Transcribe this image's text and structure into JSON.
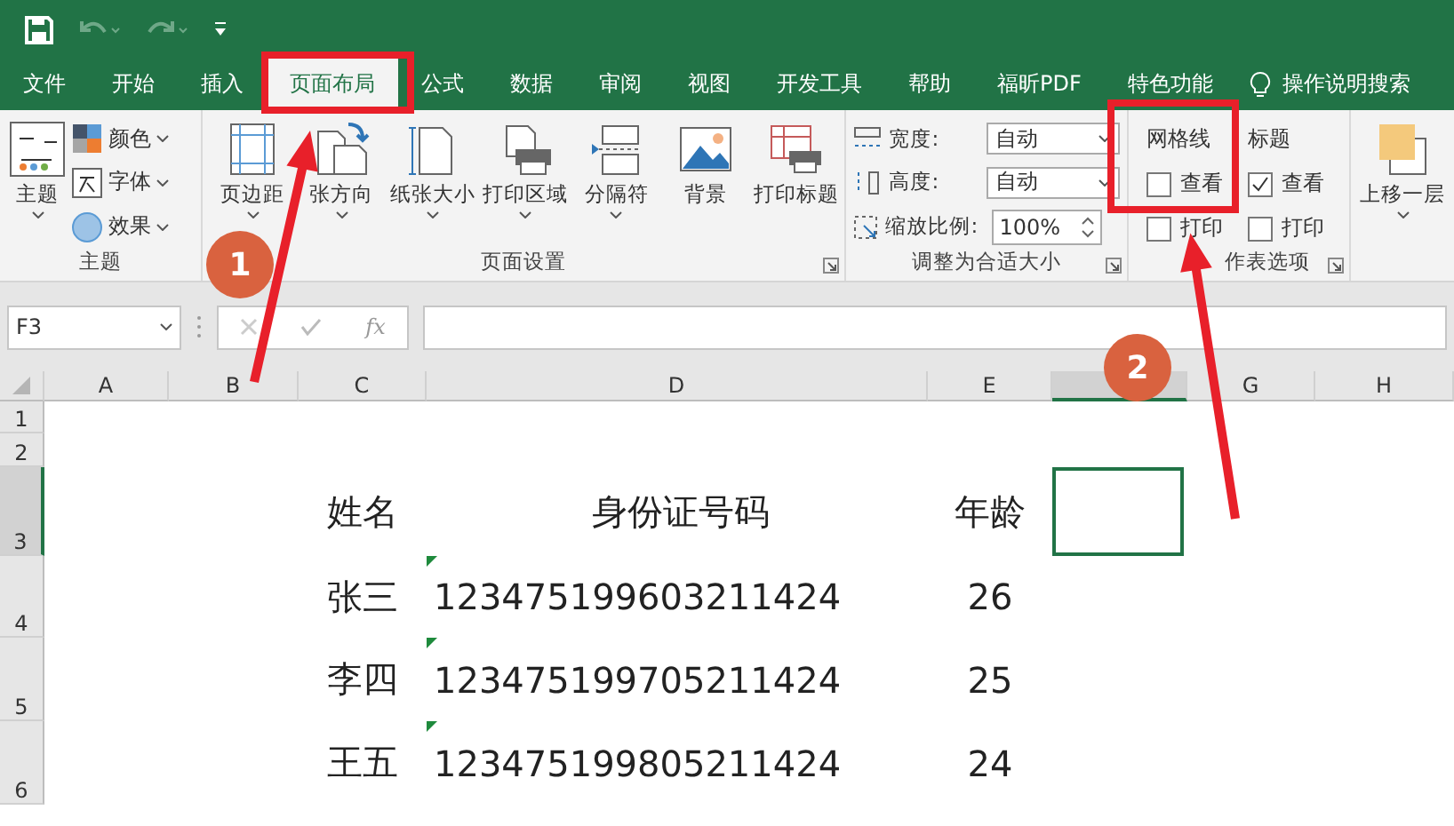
{
  "quick_access": [
    {
      "kind": "save",
      "disabled": false
    },
    {
      "kind": "undo",
      "disabled": true
    },
    {
      "kind": "redo",
      "disabled": true
    },
    {
      "kind": "customize",
      "disabled": false
    }
  ],
  "tabs": [
    {
      "label": "文件",
      "selected": false
    },
    {
      "label": "开始",
      "selected": false
    },
    {
      "label": "插入",
      "selected": false
    },
    {
      "label": "页面布局",
      "selected": true
    },
    {
      "label": "公式",
      "selected": false
    },
    {
      "label": "数据",
      "selected": false
    },
    {
      "label": "审阅",
      "selected": false
    },
    {
      "label": "视图",
      "selected": false
    },
    {
      "label": "开发工具",
      "selected": false
    },
    {
      "label": "帮助",
      "selected": false
    },
    {
      "label": "福昕PDF",
      "selected": false
    },
    {
      "label": "特色功能",
      "selected": false
    }
  ],
  "tell_me": "操作说明搜索",
  "ribbon": {
    "themes": {
      "label": "主题",
      "big": {
        "label": "主题",
        "menu": true
      },
      "items": [
        {
          "label": "颜色",
          "menu": true
        },
        {
          "label": "字体",
          "menu": true
        },
        {
          "label": "效果",
          "menu": true
        }
      ]
    },
    "page_setup": {
      "label": "页面设置",
      "launcher": true,
      "items": [
        {
          "label": "页边距",
          "menu": true
        },
        {
          "label": "张方向",
          "menu": true
        },
        {
          "label": "纸张大小",
          "menu": true
        },
        {
          "label": "打印区域",
          "menu": true
        },
        {
          "label": "分隔符",
          "menu": true
        },
        {
          "label": "背景",
          "menu": false
        },
        {
          "label": "打印标题",
          "menu": false
        }
      ]
    },
    "scale_to_fit": {
      "label": "调整为合适大小",
      "launcher": true,
      "width": {
        "label": "宽度:",
        "value": "自动"
      },
      "height": {
        "label": "高度:",
        "value": "自动"
      },
      "scale": {
        "label": "缩放比例:",
        "value": "100%"
      }
    },
    "sheet_options": {
      "label": "作表选项",
      "launcher": true,
      "columns": [
        {
          "label": "网格线",
          "view": {
            "label": "查看",
            "checked": false
          },
          "print": {
            "label": "打印",
            "checked": false
          }
        },
        {
          "label": "标题",
          "view": {
            "label": "查看",
            "checked": true
          },
          "print": {
            "label": "打印",
            "checked": false
          }
        }
      ]
    },
    "arrange": {
      "items": [
        {
          "label": "上移一层",
          "menu": true
        }
      ]
    }
  },
  "formula_bar": {
    "name_box": "F3",
    "function_label": "fx"
  },
  "columns": [
    {
      "label": "A",
      "selected": false
    },
    {
      "label": "B",
      "selected": false
    },
    {
      "label": "C",
      "selected": false
    },
    {
      "label": "D",
      "selected": false
    },
    {
      "label": "E",
      "selected": false
    },
    {
      "selected": true
    },
    {
      "label": "G",
      "selected": false
    },
    {
      "label": "H",
      "selected": false
    }
  ],
  "rows": [
    {
      "header": "1",
      "selected": false
    },
    {
      "header": "2",
      "selected": false
    },
    {
      "header": "3",
      "selected": true,
      "name": "姓名",
      "id": "身份证号码",
      "age": "年龄",
      "id_warning": false
    },
    {
      "header": "4",
      "selected": false,
      "name": "张三",
      "id": "123475199603211424",
      "age": "26",
      "id_warning": true
    },
    {
      "header": "5",
      "selected": false,
      "name": "李四",
      "id": "123475199705211424",
      "age": "25",
      "id_warning": true
    },
    {
      "header": "6",
      "selected": false,
      "name": "王五",
      "id": "123475199805211424",
      "age": "24",
      "id_warning": true
    }
  ],
  "annotations": [
    {
      "label": "1"
    },
    {
      "label": "2"
    }
  ]
}
